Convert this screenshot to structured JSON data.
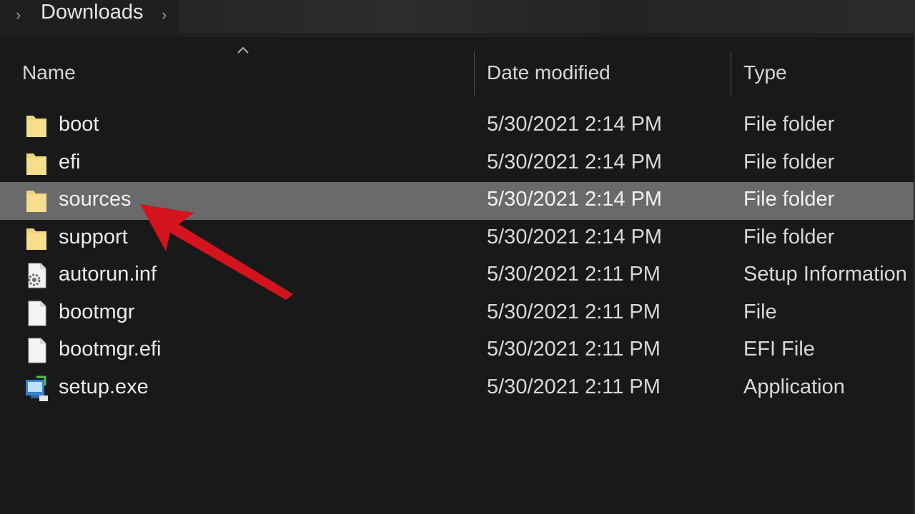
{
  "address_bar": {
    "crumb": "Downloads",
    "chevron_left": "›",
    "chevron_right": "›"
  },
  "columns": {
    "name": "Name",
    "date": "Date modified",
    "type": "Type"
  },
  "files": [
    {
      "name": "boot",
      "date": "5/30/2021 2:14 PM",
      "type": "File folder",
      "icon": "folder-icon"
    },
    {
      "name": "efi",
      "date": "5/30/2021 2:14 PM",
      "type": "File folder",
      "icon": "folder-icon"
    },
    {
      "name": "sources",
      "date": "5/30/2021 2:14 PM",
      "type": "File folder",
      "icon": "folder-icon",
      "selected": true
    },
    {
      "name": "support",
      "date": "5/30/2021 2:14 PM",
      "type": "File folder",
      "icon": "folder-icon"
    },
    {
      "name": "autorun.inf",
      "date": "5/30/2021 2:11 PM",
      "type": "Setup Information",
      "icon": "settings-file-icon"
    },
    {
      "name": "bootmgr",
      "date": "5/30/2021 2:11 PM",
      "type": "File",
      "icon": "file-icon"
    },
    {
      "name": "bootmgr.efi",
      "date": "5/30/2021 2:11 PM",
      "type": "EFI File",
      "icon": "file-icon"
    },
    {
      "name": "setup.exe",
      "date": "5/30/2021 2:11 PM",
      "type": "Application",
      "icon": "setup-app-icon"
    }
  ],
  "colors": {
    "background": "#191919",
    "selection": "#6a6a6a",
    "folder": "#f2d57a",
    "arrow": "#d3141f"
  }
}
